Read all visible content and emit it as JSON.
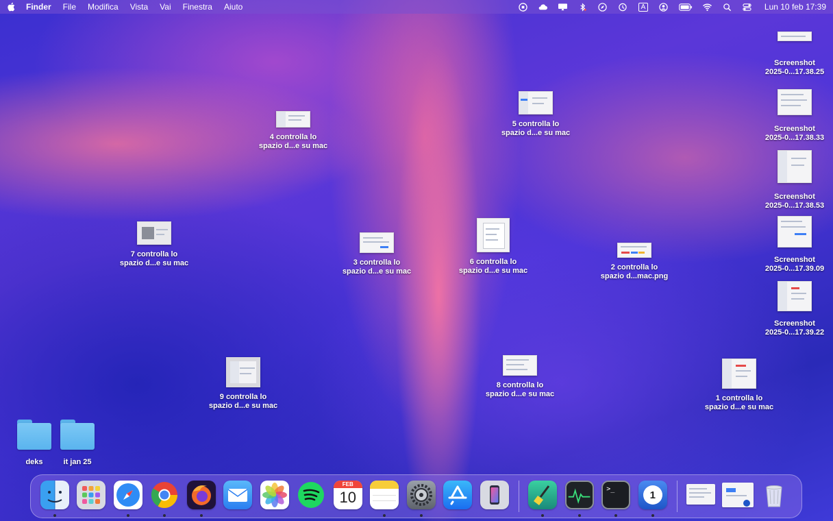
{
  "menubar": {
    "app_name": "Finder",
    "menus": [
      "File",
      "Modifica",
      "Vista",
      "Vai",
      "Finestra",
      "Aiuto"
    ],
    "clock": "Lun 10 feb  17:39",
    "status_icons": [
      "vpn-shield-icon",
      "icloud-icon",
      "display-icon",
      "bluetooth-icon",
      "safari-compass-icon",
      "time-machine-icon",
      "input-source-icon",
      "user-icon",
      "battery-icon",
      "wifi-icon",
      "spotlight-search-icon",
      "control-center-icon"
    ],
    "input_source": "A"
  },
  "desktop": {
    "files": [
      {
        "line1": "4 controlla lo",
        "line2": "spazio d...e su mac"
      },
      {
        "line1": "5 controlla lo",
        "line2": "spazio d...e su mac"
      },
      {
        "line1": "7 controlla lo",
        "line2": "spazio d...e su mac"
      },
      {
        "line1": "3 controlla lo",
        "line2": "spazio d...e su mac"
      },
      {
        "line1": "6 controlla lo",
        "line2": "spazio d...e su mac"
      },
      {
        "line1": "2 controlla lo",
        "line2": "spazio d...mac.png"
      },
      {
        "line1": "9 controlla lo",
        "line2": "spazio d...e su mac"
      },
      {
        "line1": "8 controlla lo",
        "line2": "spazio d...e su mac"
      },
      {
        "line1": "1 controlla lo",
        "line2": "spazio d...e su mac"
      }
    ],
    "screenshots": [
      {
        "line1": "Screenshot",
        "line2": "2025-0...17.38.25"
      },
      {
        "line1": "Screenshot",
        "line2": "2025-0...17.38.33"
      },
      {
        "line1": "Screenshot",
        "line2": "2025-0...17.38.53"
      },
      {
        "line1": "Screenshot",
        "line2": "2025-0...17.39.09"
      },
      {
        "line1": "Screenshot",
        "line2": "2025-0...17.39.22"
      }
    ],
    "folders": [
      {
        "label": "deks"
      },
      {
        "label": "it jan 25"
      }
    ]
  },
  "dock": {
    "apps": [
      {
        "name": "finder-icon",
        "running": true
      },
      {
        "name": "launchpad-icon",
        "running": false
      },
      {
        "name": "safari-icon",
        "running": true
      },
      {
        "name": "chrome-icon",
        "running": true
      },
      {
        "name": "firefox-icon",
        "running": true
      },
      {
        "name": "mail-icon",
        "running": false
      },
      {
        "name": "photos-icon",
        "running": false
      },
      {
        "name": "spotify-icon",
        "running": false
      },
      {
        "name": "calendar-icon",
        "running": false
      },
      {
        "name": "notes-icon",
        "running": true
      },
      {
        "name": "system-settings-icon",
        "running": true
      },
      {
        "name": "app-store-icon",
        "running": false
      },
      {
        "name": "iphone-mirroring-icon",
        "running": false
      },
      {
        "name": "cleaner-broom-icon",
        "running": true
      },
      {
        "name": "activity-monitor-icon",
        "running": true
      },
      {
        "name": "terminal-icon",
        "running": true
      },
      {
        "name": "1password-icon",
        "running": true
      }
    ],
    "calendar": {
      "month": "FEB",
      "day": "10"
    },
    "terminal_prompt": ">_",
    "onepassword_glyph": "1"
  }
}
